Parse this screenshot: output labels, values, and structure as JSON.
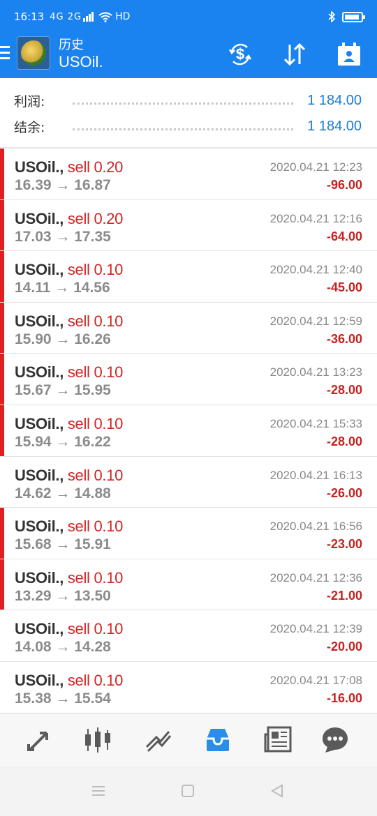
{
  "status_bar": {
    "time": "16:13",
    "network": "4G 2G",
    "hd": "HD"
  },
  "app_bar": {
    "section_title": "历史",
    "symbol_title": "USOil.",
    "icons": [
      "menu-icon",
      "app-logo",
      "currency-exchange-icon",
      "sort-icon",
      "calendar-icon"
    ]
  },
  "summary": {
    "profit_label": "利润:",
    "profit_value": "1 184.00",
    "balance_label": "结余:",
    "balance_value": "1 184.00"
  },
  "deals": [
    {
      "symbol": "USOil.,",
      "type": "sell 0.20",
      "open": "16.39",
      "close": "16.87",
      "time": "2020.04.21 12:23",
      "profit": "-96.00",
      "marked": true
    },
    {
      "symbol": "USOil.,",
      "type": "sell 0.20",
      "open": "17.03",
      "close": "17.35",
      "time": "2020.04.21 12:16",
      "profit": "-64.00",
      "marked": true
    },
    {
      "symbol": "USOil.,",
      "type": "sell 0.10",
      "open": "14.11",
      "close": "14.56",
      "time": "2020.04.21 12:40",
      "profit": "-45.00",
      "marked": true
    },
    {
      "symbol": "USOil.,",
      "type": "sell 0.10",
      "open": "15.90",
      "close": "16.26",
      "time": "2020.04.21 12:59",
      "profit": "-36.00",
      "marked": true
    },
    {
      "symbol": "USOil.,",
      "type": "sell 0.10",
      "open": "15.67",
      "close": "15.95",
      "time": "2020.04.21 13:23",
      "profit": "-28.00",
      "marked": true
    },
    {
      "symbol": "USOil.,",
      "type": "sell 0.10",
      "open": "15.94",
      "close": "16.22",
      "time": "2020.04.21 15:33",
      "profit": "-28.00",
      "marked": true
    },
    {
      "symbol": "USOil.,",
      "type": "sell 0.10",
      "open": "14.62",
      "close": "14.88",
      "time": "2020.04.21 16:13",
      "profit": "-26.00",
      "marked": false
    },
    {
      "symbol": "USOil.,",
      "type": "sell 0.10",
      "open": "15.68",
      "close": "15.91",
      "time": "2020.04.21 16:56",
      "profit": "-23.00",
      "marked": true
    },
    {
      "symbol": "USOil.,",
      "type": "sell 0.10",
      "open": "13.29",
      "close": "13.50",
      "time": "2020.04.21 12:36",
      "profit": "-21.00",
      "marked": true
    },
    {
      "symbol": "USOil.,",
      "type": "sell 0.10",
      "open": "14.08",
      "close": "14.28",
      "time": "2020.04.21 12:39",
      "profit": "-20.00",
      "marked": false
    },
    {
      "symbol": "USOil.,",
      "type": "sell 0.10",
      "open": "15.38",
      "close": "15.54",
      "time": "2020.04.21 17:08",
      "profit": "-16.00",
      "marked": false
    }
  ],
  "bottom_tabs": [
    {
      "icon": "quotes-icon",
      "active": false
    },
    {
      "icon": "chart-icon",
      "active": false
    },
    {
      "icon": "trade-icon",
      "active": false
    },
    {
      "icon": "history-icon",
      "active": true
    },
    {
      "icon": "news-icon",
      "active": false
    },
    {
      "icon": "messages-icon",
      "active": false
    }
  ],
  "colors": {
    "primary": "#1a83f0",
    "loss": "#d42323",
    "active_tab": "#2a8ee8",
    "inactive_tab": "#5a5a5a"
  }
}
